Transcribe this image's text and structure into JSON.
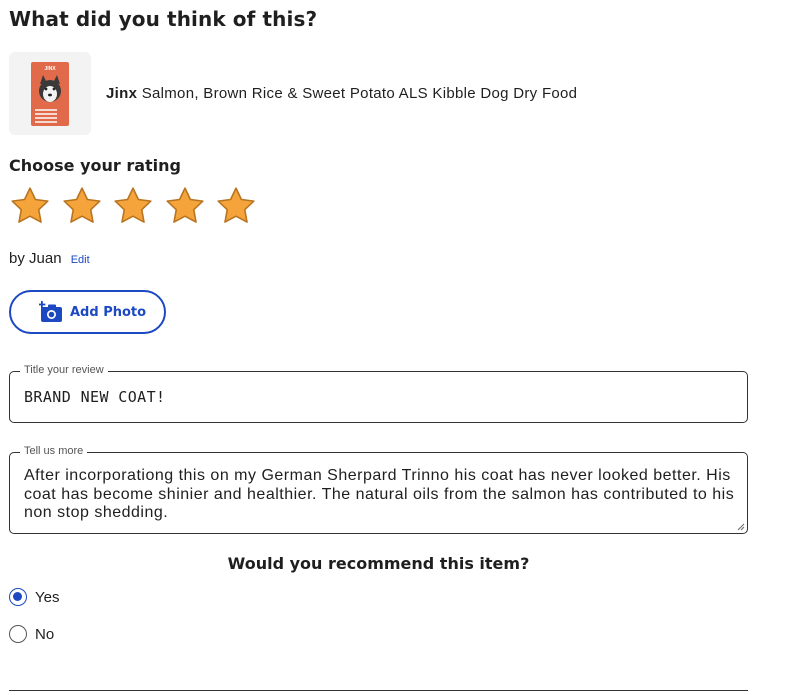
{
  "page": {
    "heading": "What did you think of this?"
  },
  "product": {
    "brand": "Jinx",
    "name": "Salmon, Brown Rice & Sweet Potato ALS Kibble Dog Dry Food",
    "thumb_brand_text": "JINX"
  },
  "rating": {
    "label": "Choose your rating",
    "value": 5,
    "max": 5,
    "star_color": "#f4a43b"
  },
  "author": {
    "byline": "by Juan",
    "edit_label": "Edit"
  },
  "add_photo": {
    "label": "Add Photo"
  },
  "review_title": {
    "legend": "Title your review",
    "value": "BRAND NEW COAT!"
  },
  "review_body": {
    "legend": "Tell us more",
    "value": "After incorporationg this on my German Sherpard Trinno his coat has never looked better. His coat has become shinier and healthier. The natural oils from the salmon has contributed to his non stop shedding."
  },
  "recommend": {
    "question": "Would you recommend this item?",
    "options": [
      {
        "label": "Yes",
        "selected": true
      },
      {
        "label": "No",
        "selected": false
      }
    ]
  },
  "colors": {
    "accent": "#1c49c2",
    "star": "#f4a43b",
    "text": "#1f1f1f"
  }
}
